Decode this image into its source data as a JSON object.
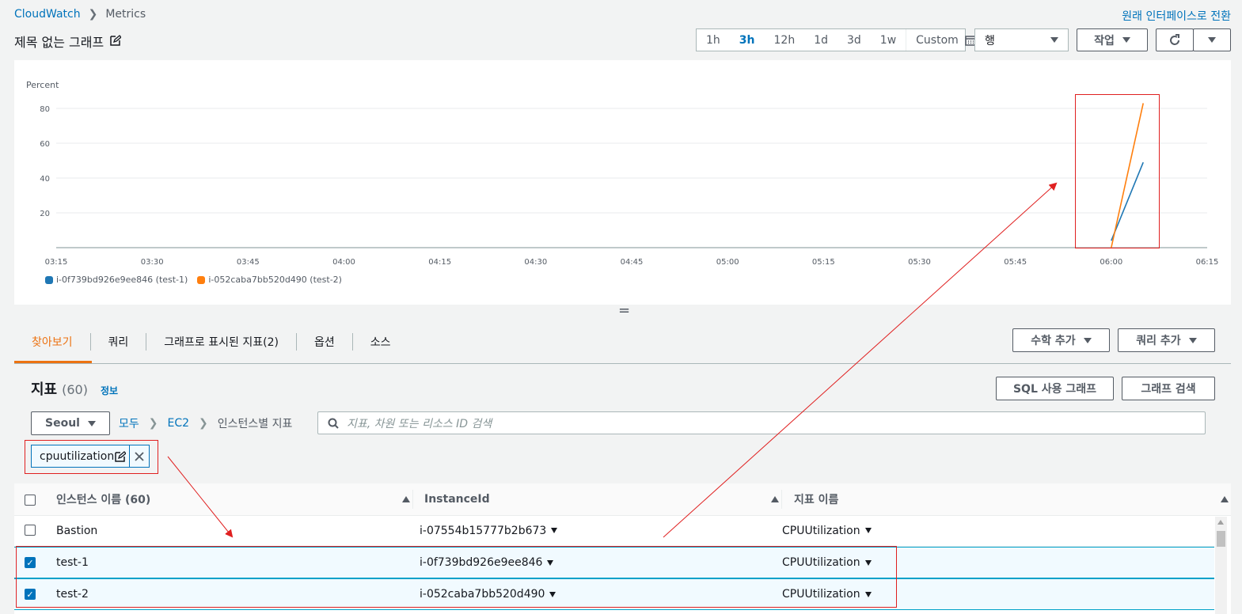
{
  "breadcrumb": {
    "root": "CloudWatch",
    "current": "Metrics"
  },
  "original_interface_link": "원래 인터페이스로 전환",
  "graph_title": "제목 없는 그래프",
  "time_ranges": [
    "1h",
    "3h",
    "12h",
    "1d",
    "3d",
    "1w"
  ],
  "time_range_selected": "3h",
  "time_custom": "Custom",
  "layout_select": "행",
  "actions_label": "작업",
  "chart_data": {
    "type": "line",
    "ylabel": "Percent",
    "y_ticks": [
      "20",
      "40",
      "60",
      "80"
    ],
    "x_ticks": [
      "03:15",
      "03:30",
      "03:45",
      "04:00",
      "04:15",
      "04:30",
      "04:45",
      "05:00",
      "05:15",
      "05:30",
      "05:45",
      "06:00",
      "06:15"
    ],
    "ylim": [
      0,
      90
    ],
    "series": [
      {
        "name": "i-0f739bd926e9ee846 (test-1)",
        "color": "#1f77b4",
        "x": [
          "06:00",
          "06:05"
        ],
        "values": [
          4,
          49
        ]
      },
      {
        "name": "i-052caba7bb520d490 (test-2)",
        "color": "#ff7f0e",
        "x": [
          "06:00",
          "06:05"
        ],
        "values": [
          0,
          83
        ]
      }
    ]
  },
  "tabs": [
    "찾아보기",
    "쿼리",
    "그래프로 표시된 지표(2)",
    "옵션",
    "소스"
  ],
  "tab_active": "찾아보기",
  "math_button": "수학 추가",
  "query_button": "쿼리 추가",
  "metrics": {
    "title": "지표",
    "count": "(60)",
    "info": "정보"
  },
  "sql_button": "SQL 사용 그래프",
  "graph_search_button": "그래프 검색",
  "region": "Seoul",
  "path": [
    "모두",
    "EC2",
    "인스턴스별 지표"
  ],
  "search_placeholder": "지표, 차원 또는 리소스 ID 검색",
  "filter_token": "cpuutilization",
  "table": {
    "columns": [
      "인스턴스 이름 (60)",
      "InstanceId",
      "지표 이름"
    ],
    "rows": [
      {
        "name": "Bastion",
        "id": "i-07554b15777b2b673",
        "metric": "CPUUtilization",
        "checked": false
      },
      {
        "name": "test-1",
        "id": "i-0f739bd926e9ee846",
        "metric": "CPUUtilization",
        "checked": true
      },
      {
        "name": "test-2",
        "id": "i-052caba7bb520d490",
        "metric": "CPUUtilization",
        "checked": true
      }
    ]
  }
}
